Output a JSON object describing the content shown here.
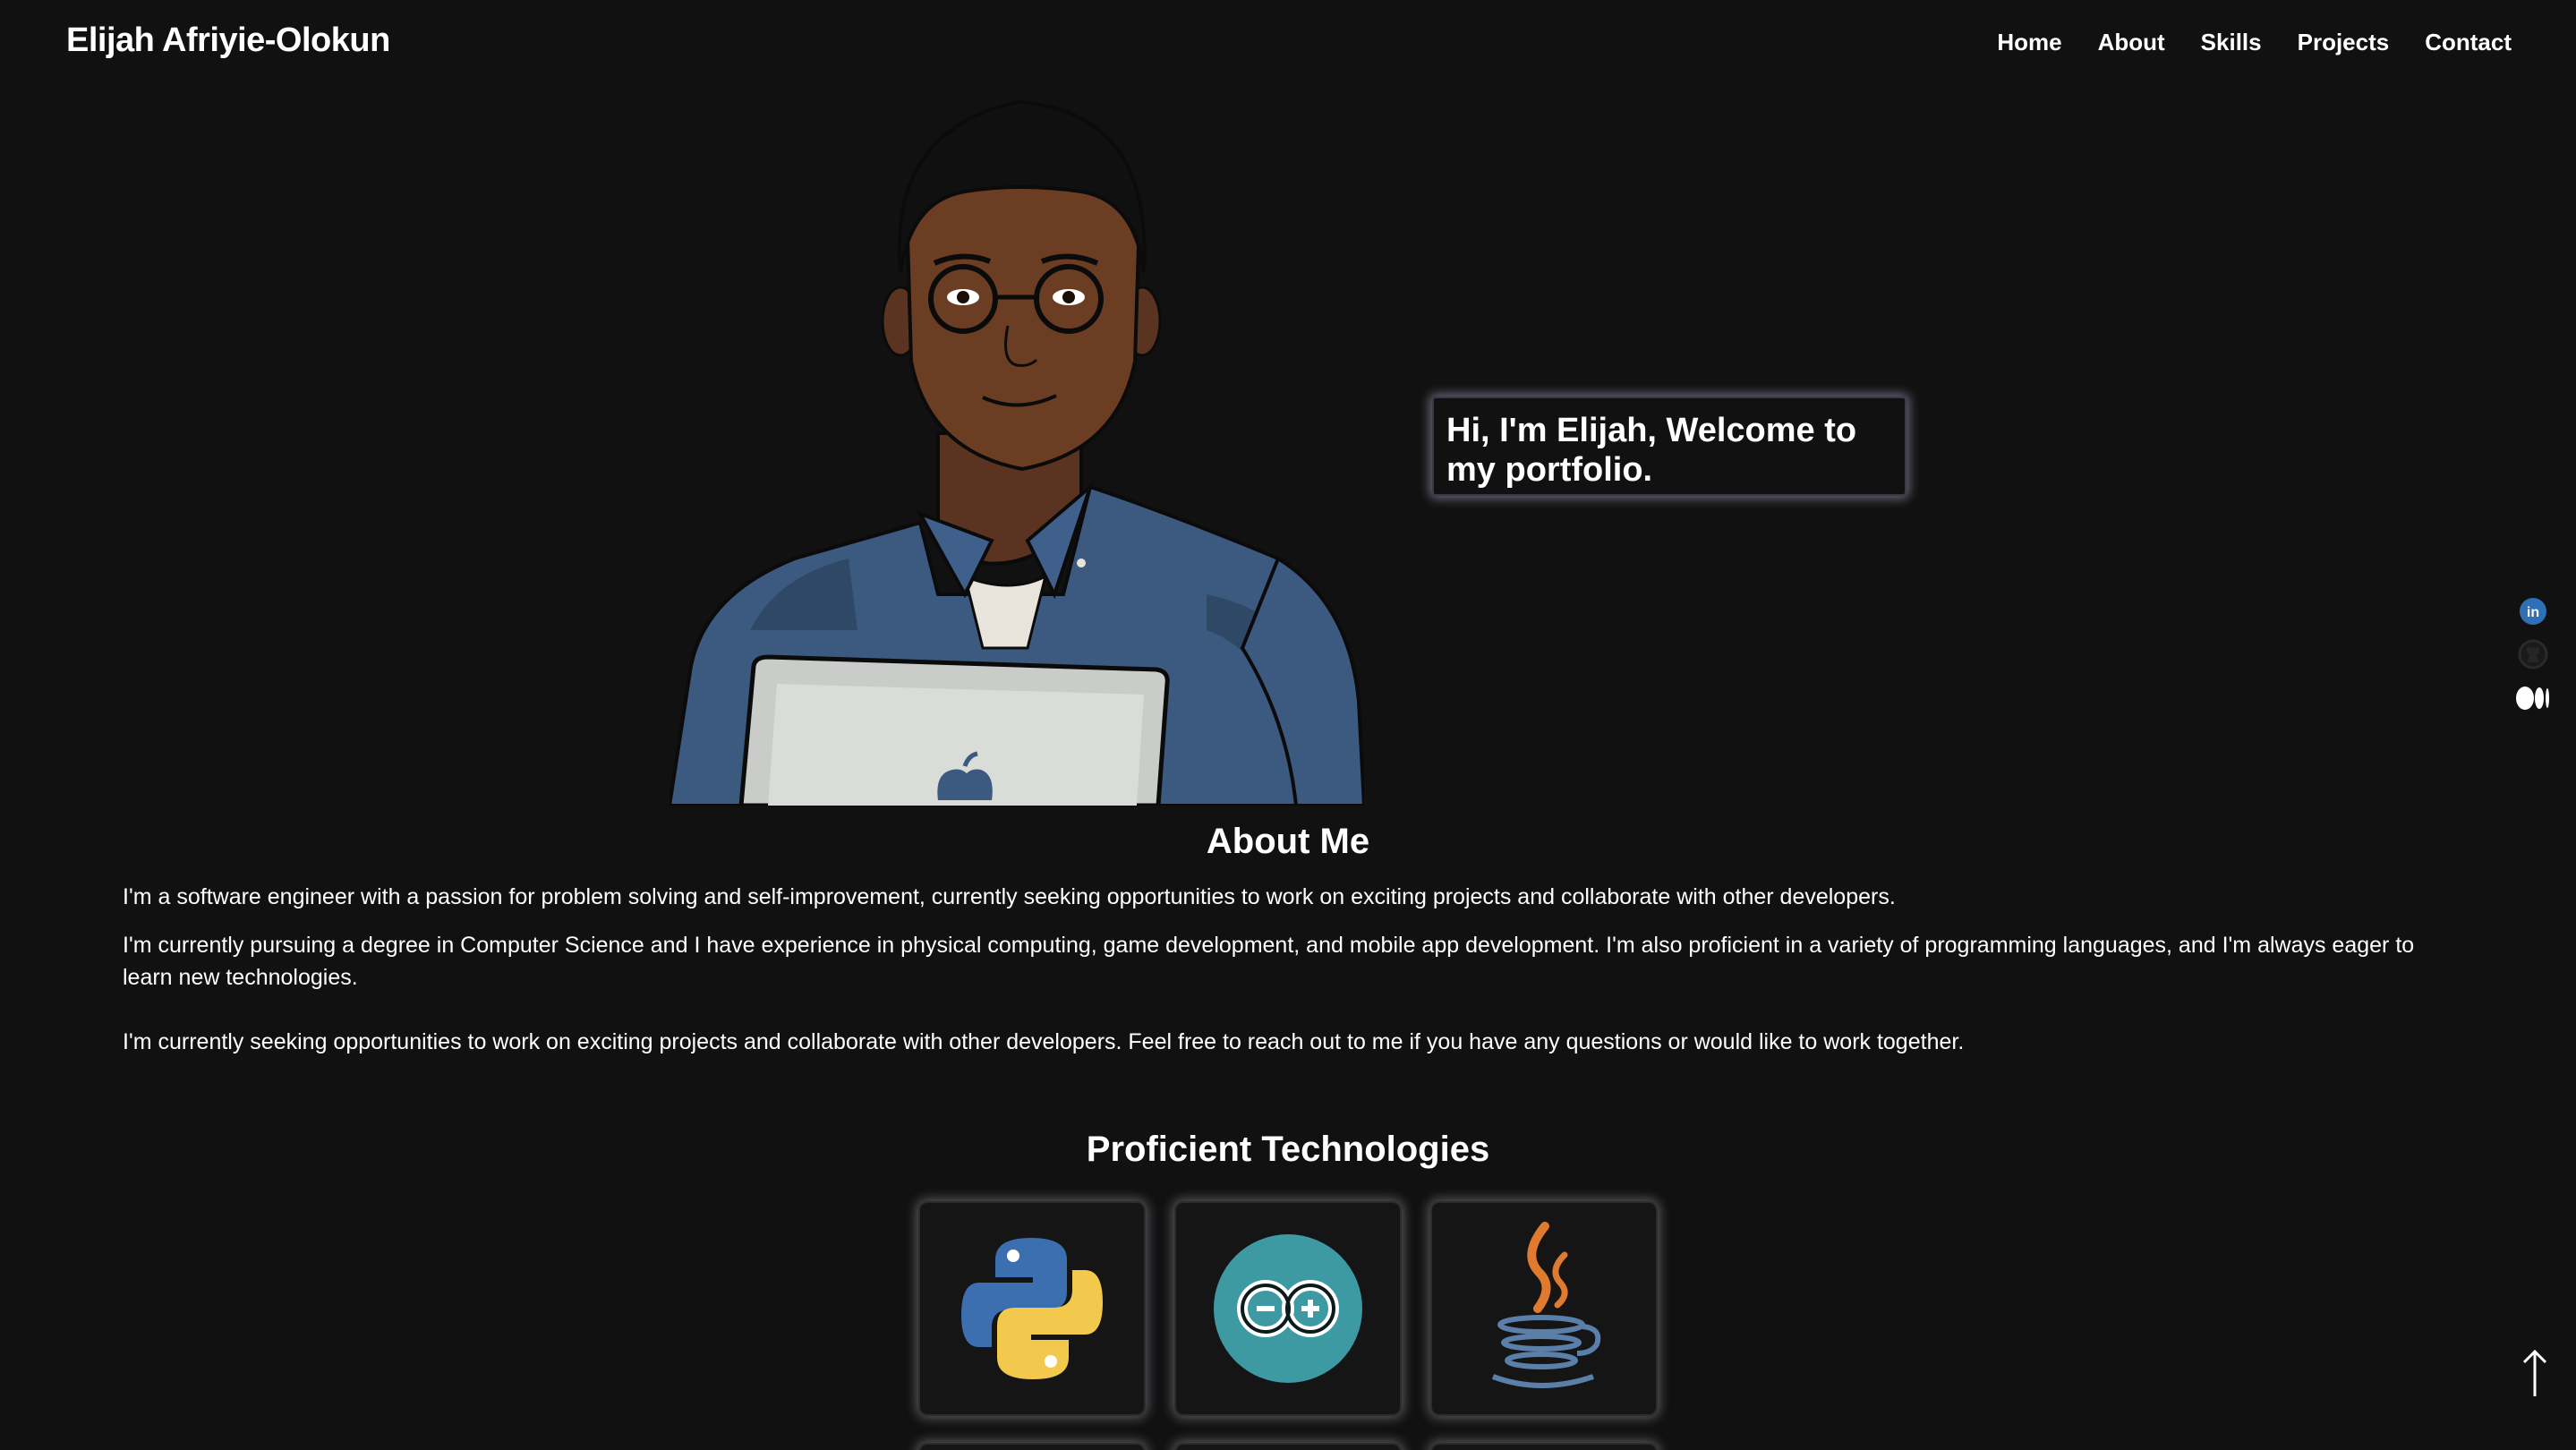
{
  "header": {
    "site_title": "Elijah Afriyie-Olokun",
    "nav": [
      "Home",
      "About",
      "Skills",
      "Projects",
      "Contact"
    ]
  },
  "hero": {
    "greeting": "Hi, I'm Elijah, Welcome to my portfolio."
  },
  "about": {
    "title": "About Me",
    "paragraphs": [
      "I'm a software engineer with a passion for problem solving and self-improvement, currently seeking opportunities to work on exciting projects and collaborate with other developers.",
      "I'm currently pursuing a degree in Computer Science and I have experience in physical computing, game development, and mobile app development. I'm also proficient in a variety of programming languages, and I'm always eager to learn new technologies.",
      "I'm currently seeking opportunities to work on exciting projects and collaborate with other developers. Feel free to reach out to me if you have any questions or would like to work together."
    ]
  },
  "technologies": {
    "title": "Proficient Technologies",
    "items": [
      "python-icon",
      "arduino-icon",
      "java-icon"
    ]
  },
  "social": [
    "linkedin-icon",
    "github-icon",
    "medium-icon"
  ],
  "colors": {
    "background": "#111111",
    "text": "#ffffff",
    "card_glow": "#d2d2e6",
    "linkedin": "#2e6fb5",
    "python_blue": "#3b6fb0",
    "python_yellow": "#f2c94c",
    "arduino_teal": "#3d9aa3",
    "java_orange": "#e07a2f",
    "java_blue": "#5a7fa8"
  },
  "icons": {
    "scroll_top": "arrow-up-icon"
  }
}
